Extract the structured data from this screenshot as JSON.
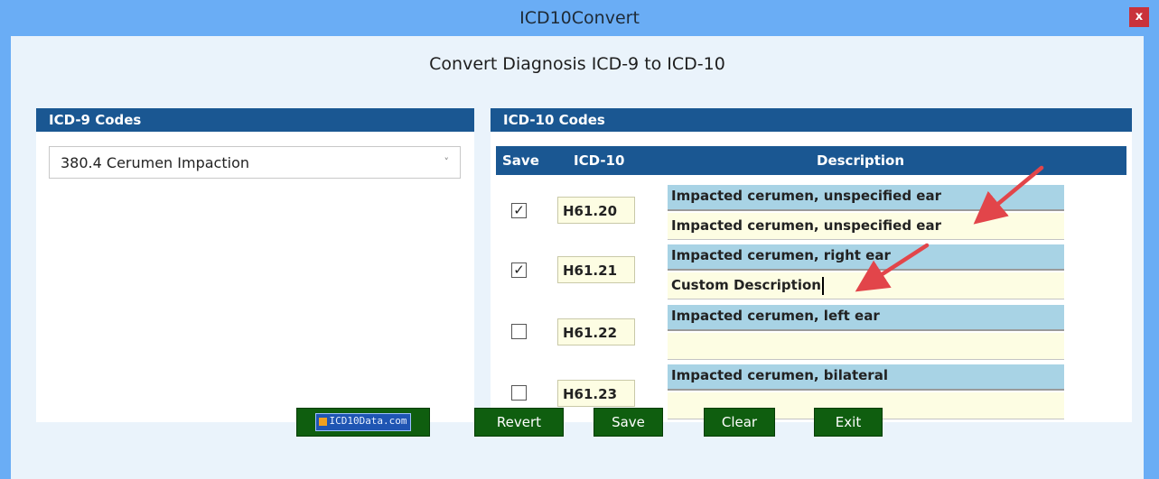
{
  "window": {
    "title": "ICD10Convert",
    "close_label": "x"
  },
  "heading": "Convert Diagnosis ICD-9 to ICD-10",
  "icd9": {
    "header": "ICD-9 Codes",
    "selected": "380.4  Cerumen Impaction",
    "chevron": "˅"
  },
  "icd10": {
    "header": "ICD-10 Codes",
    "columns": {
      "save": "Save",
      "code": "ICD-10",
      "description": "Description"
    },
    "rows": [
      {
        "checked": "✓",
        "code": "H61.20",
        "official_description": "Impacted cerumen, unspecified ear",
        "custom_description": "Impacted cerumen, unspecified ear"
      },
      {
        "checked": "✓",
        "code": "H61.21",
        "official_description": "Impacted cerumen, right ear",
        "custom_description": "Custom Description"
      },
      {
        "checked": "",
        "code": "H61.22",
        "official_description": "Impacted cerumen, left ear",
        "custom_description": ""
      },
      {
        "checked": "",
        "code": "H61.23",
        "official_description": "Impacted cerumen, bilateral",
        "custom_description": ""
      }
    ]
  },
  "buttons": {
    "logo_label": "ICD10Data.com",
    "revert": "Revert",
    "save": "Save",
    "clear": "Clear",
    "exit": "Exit"
  },
  "colors": {
    "title_bar": "#6aadf5",
    "panel_header": "#1a5792",
    "description_header": "#a8d3e5",
    "editable_field": "#fdfde3",
    "button": "#0f5e0f",
    "close_button": "#c9323a",
    "annotation_arrow": "#e2454a"
  }
}
